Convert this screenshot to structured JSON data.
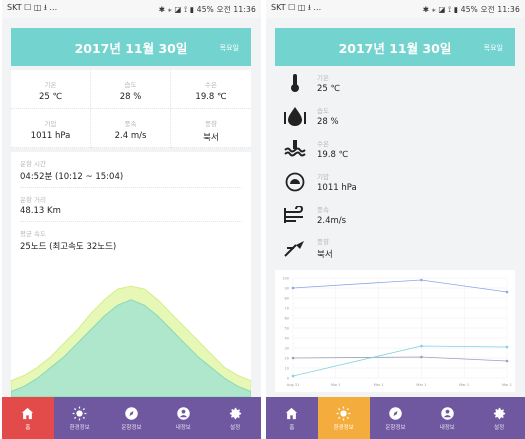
{
  "status": {
    "left": {
      "carrier": "SKT",
      "icons": "☐ ◫ ⭳ …"
    },
    "right": {
      "icons": "✱ ⁎ ◪ ⟟ ▮",
      "battery": "45%",
      "time": "오전 11:36"
    }
  },
  "header": {
    "date": "2017년 11월 30일",
    "day": "목요일"
  },
  "left_grid": [
    {
      "label": "기온",
      "value": "25 ℃"
    },
    {
      "label": "습도",
      "value": "28 %"
    },
    {
      "label": "수온",
      "value": "19.8 ℃"
    },
    {
      "label": "기압",
      "value": "1011 hPa"
    },
    {
      "label": "풍속",
      "value": "2.4 m/s"
    },
    {
      "label": "풍향",
      "value": "북서"
    }
  ],
  "left_info": [
    {
      "label": "운항 시간",
      "value": "04:52분 (10:12 ~ 15:04)"
    },
    {
      "label": "운항 거리",
      "value": "48.13 Km"
    },
    {
      "label": "평균 속도",
      "value": "25노드 (최고속도 32노드)"
    }
  ],
  "right_list": [
    {
      "icon": "thermometer-icon",
      "label": "기온",
      "value": "25 ℃"
    },
    {
      "icon": "humidity-icon",
      "label": "습도",
      "value": "28 %"
    },
    {
      "icon": "water-temperature-icon",
      "label": "수온",
      "value": "19.8 ℃"
    },
    {
      "icon": "pressure-icon",
      "label": "기압",
      "value": "1011 hPa"
    },
    {
      "icon": "wind-speed-icon",
      "label": "풍속",
      "value": "2.4m/s"
    },
    {
      "icon": "wind-direction-icon",
      "label": "풍향",
      "value": "북서"
    }
  ],
  "tabs": [
    {
      "icon": "home-icon",
      "label": "홈"
    },
    {
      "icon": "sun-icon",
      "label": "환경정보"
    },
    {
      "icon": "compass-icon",
      "label": "운항정보"
    },
    {
      "icon": "user-icon",
      "label": "내정보"
    },
    {
      "icon": "gear-icon",
      "label": "설정"
    }
  ],
  "colors": {
    "header": "#72d3cf",
    "tabbar": "#6f58a0",
    "home_active": "#e34a4a",
    "env_active": "#f4ad3c",
    "area_outer": "#e6f7b6",
    "area_inner": "#a8e6cf"
  },
  "chart_data": [
    {
      "type": "area",
      "x": [
        0,
        1,
        2,
        3,
        4,
        5,
        6,
        7,
        8,
        9,
        10,
        11,
        12,
        13,
        14,
        15,
        16,
        17,
        18
      ],
      "series": [
        {
          "values": [
            12,
            16,
            22,
            30,
            40,
            50,
            62,
            72,
            80,
            82,
            80,
            72,
            62,
            52,
            42,
            32,
            22,
            16,
            12
          ]
        },
        {
          "values": [
            4,
            8,
            14,
            22,
            30,
            40,
            50,
            60,
            68,
            72,
            68,
            60,
            50,
            40,
            30,
            22,
            14,
            8,
            4
          ]
        }
      ],
      "ylim": [
        0,
        100
      ],
      "grid": false
    },
    {
      "type": "line",
      "categories": [
        "Aug 31",
        "Mar 1",
        "Mar 1",
        "Mar 1",
        "Mar 1",
        "Mar 1"
      ],
      "series": [
        {
          "values": [
            90,
            null,
            null,
            98,
            null,
            86
          ]
        },
        {
          "values": [
            20,
            null,
            null,
            21,
            null,
            17
          ]
        },
        {
          "values": [
            2,
            null,
            null,
            32,
            null,
            31
          ]
        }
      ],
      "y_ticks": [
        0,
        10,
        20,
        30,
        40,
        50,
        60,
        70,
        80,
        90,
        100
      ],
      "ylim": [
        0,
        100
      ],
      "grid": true
    }
  ]
}
